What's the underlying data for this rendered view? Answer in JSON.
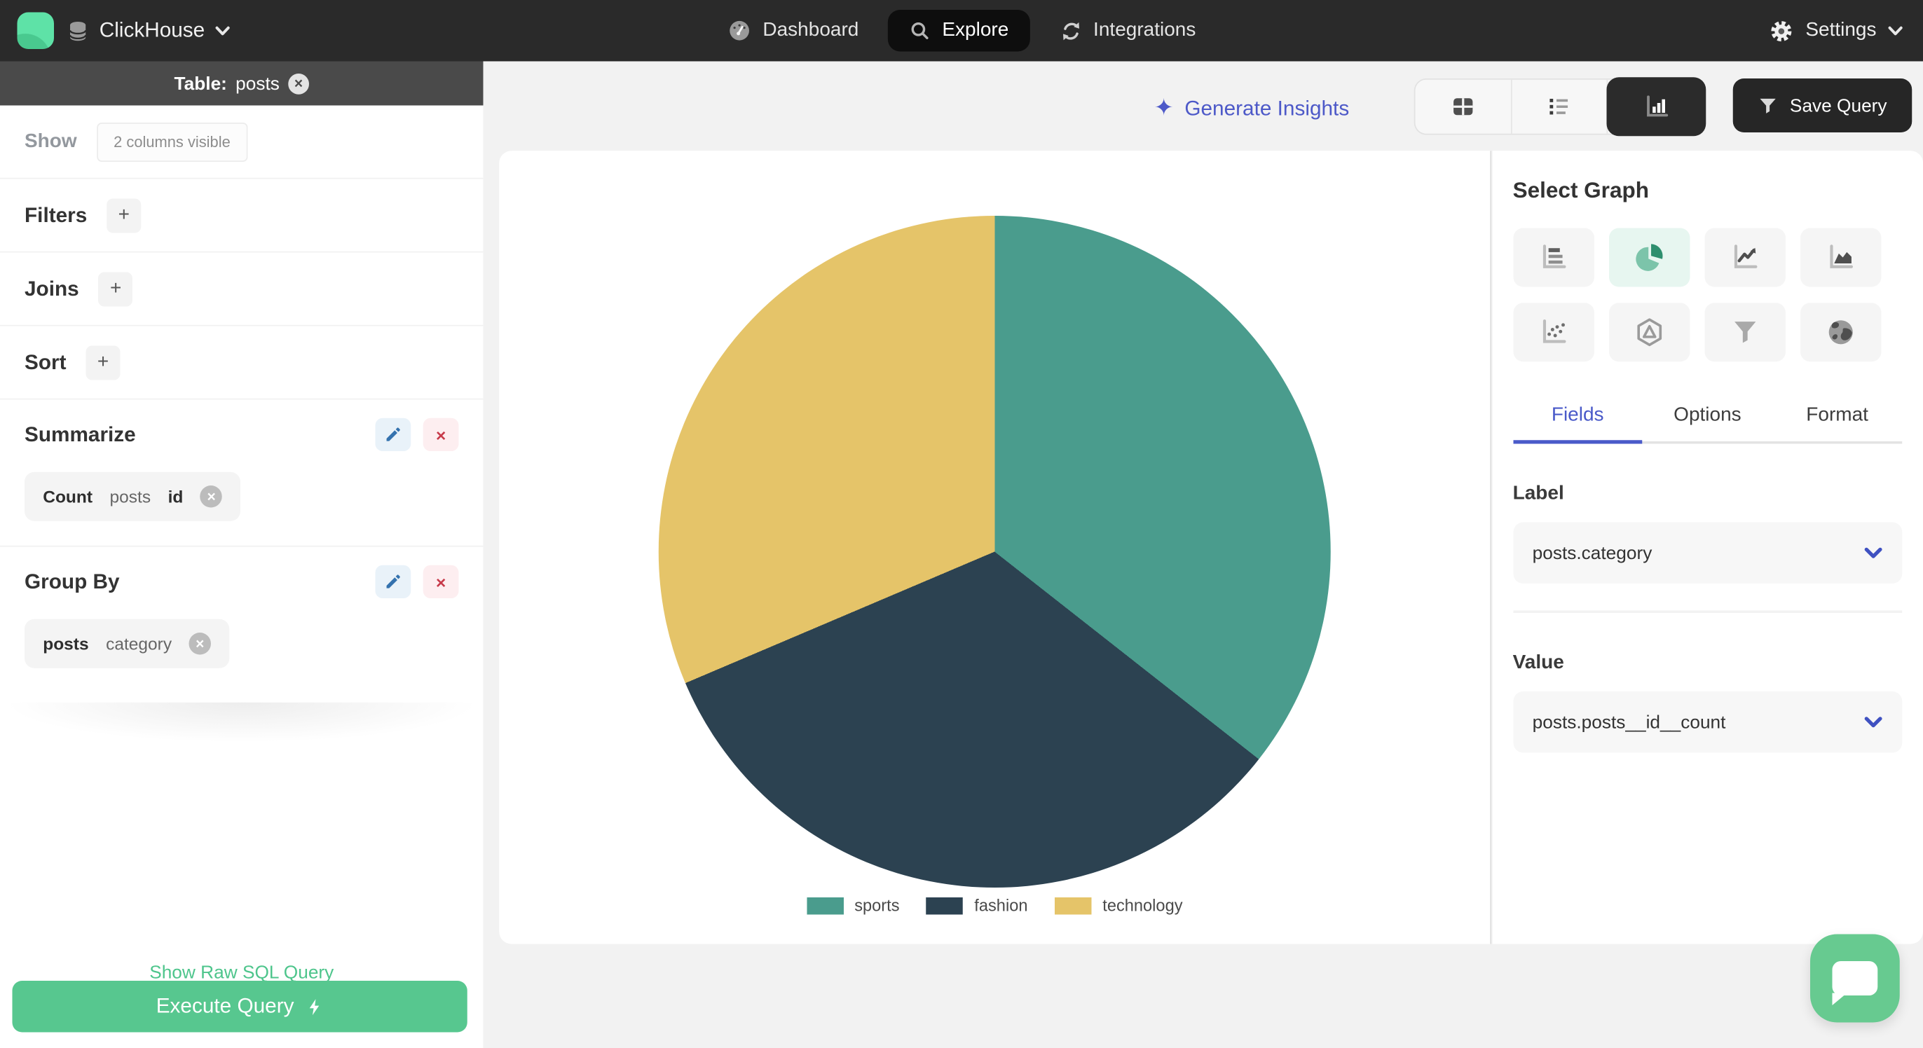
{
  "nav": {
    "brand": "ClickHouse",
    "items": [
      {
        "label": "Dashboard",
        "active": false
      },
      {
        "label": "Explore",
        "active": true
      },
      {
        "label": "Integrations",
        "active": false
      }
    ],
    "settings": "Settings"
  },
  "sidebar": {
    "table_bar": {
      "prefix": "Table:",
      "name": "posts"
    },
    "show": {
      "label": "Show",
      "badge": "2 columns visible"
    },
    "filters": {
      "label": "Filters",
      "add": "+"
    },
    "joins": {
      "label": "Joins",
      "add": "+"
    },
    "sort": {
      "label": "Sort",
      "add": "+"
    },
    "summarize": {
      "label": "Summarize",
      "chip": {
        "agg": "Count",
        "table": "posts",
        "column": "id"
      }
    },
    "group_by": {
      "label": "Group By",
      "chip": {
        "table": "posts",
        "column": "category"
      }
    },
    "raw_sql_link": "Show Raw SQL Query",
    "execute_button": "Execute Query"
  },
  "toolbar": {
    "generate_insights": "Generate Insights",
    "save_query": "Save Query"
  },
  "graph_panel": {
    "title": "Select Graph",
    "graph_types": [
      "horizontal-bar",
      "pie",
      "line",
      "area",
      "scatter",
      "radar",
      "funnel",
      "map"
    ],
    "active_graph": "pie",
    "tabs": [
      {
        "label": "Fields",
        "active": true
      },
      {
        "label": "Options",
        "active": false
      },
      {
        "label": "Format",
        "active": false
      }
    ],
    "label_section": {
      "heading": "Label",
      "value": "posts.category"
    },
    "value_section": {
      "heading": "Value",
      "value": "posts.posts__id__count"
    }
  },
  "chart_data": {
    "type": "pie",
    "labels": [
      "sports",
      "fashion",
      "technology"
    ],
    "values_pct": [
      35.6,
      33.0,
      31.4
    ],
    "colors": [
      "#4A9C8D",
      "#2C4251",
      "#E5C469"
    ],
    "title": "",
    "legend_position": "bottom",
    "start_angle_deg": 0,
    "direction": "clockwise"
  },
  "icons": {
    "logo": "green-rounded-square",
    "database-icon": "cylinder",
    "dashboard-icon": "gauge",
    "explore-icon": "magnifier",
    "integrations-icon": "sync-arrows",
    "settings-icon": "gear",
    "chevron-down-icon": "v",
    "sparkle-icon": "✦",
    "close-icon": "×",
    "add-icon": "+",
    "edit-icon": "pencil",
    "remove-icon": "×",
    "bolt-icon": "lightning",
    "view-table-icon": "grid",
    "view-list-icon": "list",
    "view-chart-icon": "bar-chart",
    "save-icon": "funnel",
    "chat-icon": "speech-bubble"
  },
  "colors": {
    "accent_green": "#57C78F",
    "brand_green": "#5BDF9F",
    "indigo": "#4D59C8",
    "mint_active": "#E7F6F0",
    "danger": "#C73A4A",
    "edit_blue": "#3472AE",
    "dark": "#2A2A2A"
  }
}
